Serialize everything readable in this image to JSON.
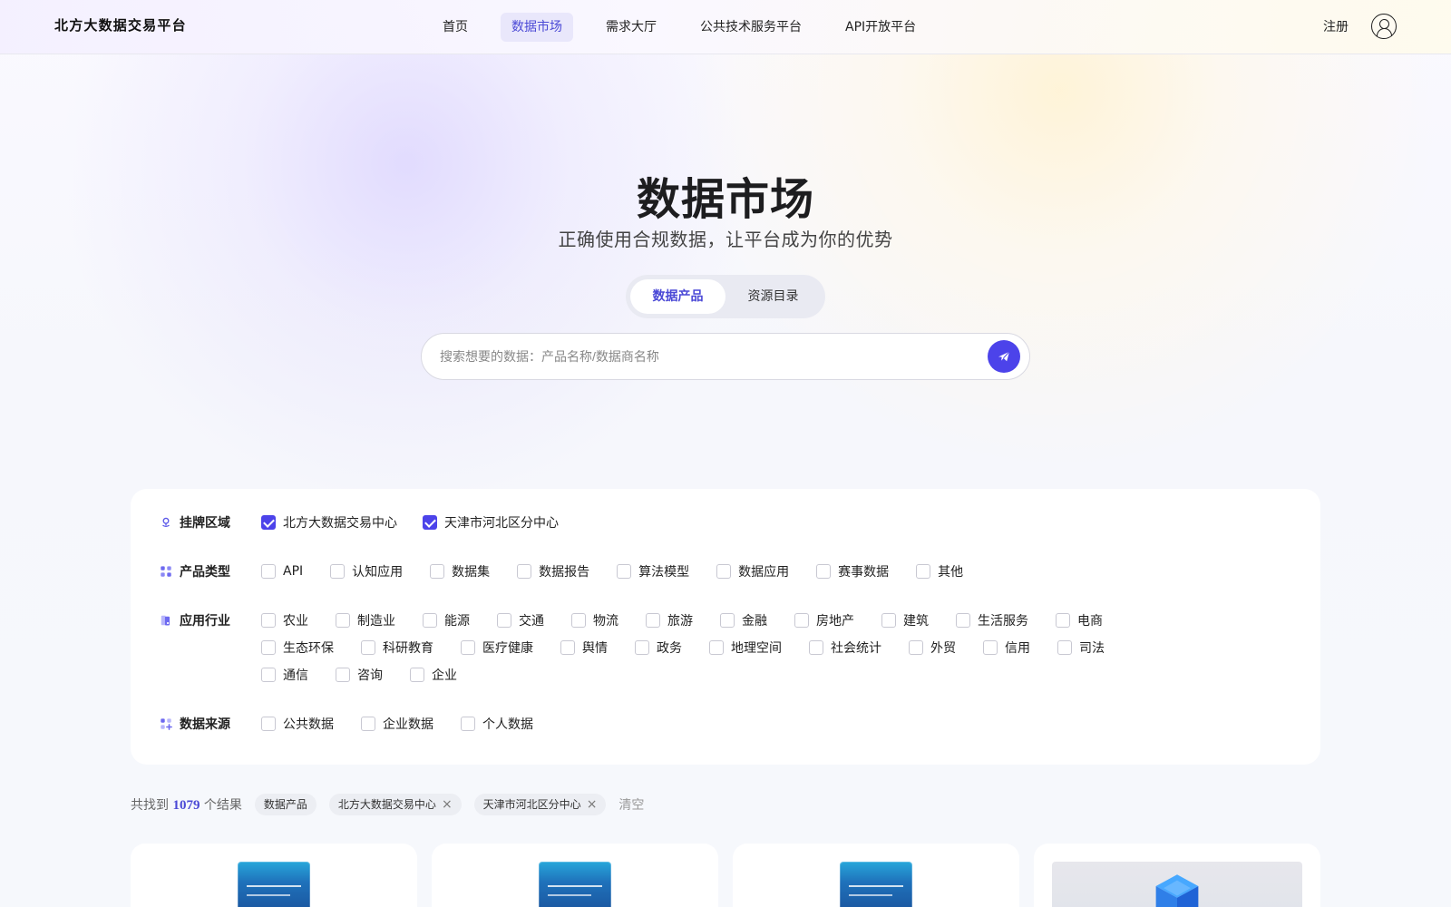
{
  "brand": {
    "title": "北方大数据交易平台"
  },
  "nav": {
    "items": [
      {
        "label": "首页"
      },
      {
        "label": "数据市场",
        "active": true
      },
      {
        "label": "需求大厅"
      },
      {
        "label": "公共技术服务平台"
      },
      {
        "label": "API开放平台"
      }
    ],
    "register": "注册"
  },
  "hero": {
    "title": "数据市场",
    "subtitle": "正确使用合规数据，让平台成为你的优势"
  },
  "toggle": {
    "items": [
      {
        "label": "数据产品",
        "active": true
      },
      {
        "label": "资源目录"
      }
    ]
  },
  "search": {
    "placeholder": "搜索想要的数据：产品名称/数据商名称"
  },
  "filters": {
    "region": {
      "label": "挂牌区域",
      "options": [
        {
          "label": "北方大数据交易中心",
          "checked": true
        },
        {
          "label": "天津市河北区分中心",
          "checked": true
        }
      ]
    },
    "product_type": {
      "label": "产品类型",
      "options": [
        {
          "label": "API"
        },
        {
          "label": "认知应用"
        },
        {
          "label": "数据集"
        },
        {
          "label": "数据报告"
        },
        {
          "label": "算法模型"
        },
        {
          "label": "数据应用"
        },
        {
          "label": "赛事数据"
        },
        {
          "label": "其他"
        }
      ]
    },
    "industry": {
      "label": "应用行业",
      "lines": [
        [
          {
            "label": "农业"
          },
          {
            "label": "制造业"
          },
          {
            "label": "能源"
          },
          {
            "label": "交通"
          },
          {
            "label": "物流"
          },
          {
            "label": "旅游"
          },
          {
            "label": "金融"
          },
          {
            "label": "房地产"
          },
          {
            "label": "建筑"
          },
          {
            "label": "生活服务"
          },
          {
            "label": "电商"
          }
        ],
        [
          {
            "label": "生态环保"
          },
          {
            "label": "科研教育"
          },
          {
            "label": "医疗健康"
          },
          {
            "label": "舆情"
          },
          {
            "label": "政务"
          },
          {
            "label": "地理空间"
          },
          {
            "label": "社会统计"
          },
          {
            "label": "外贸"
          },
          {
            "label": "信用"
          },
          {
            "label": "司法"
          }
        ],
        [
          {
            "label": "通信"
          },
          {
            "label": "咨询"
          },
          {
            "label": "企业"
          }
        ]
      ]
    },
    "source": {
      "label": "数据来源",
      "options": [
        {
          "label": "公共数据"
        },
        {
          "label": "企业数据"
        },
        {
          "label": "个人数据"
        }
      ]
    }
  },
  "results": {
    "prefix": "共找到",
    "count": "1079",
    "suffix": "个结果",
    "chips": [
      {
        "label": "数据产品"
      },
      {
        "label": "北方大数据交易中心",
        "removable": true
      },
      {
        "label": "天津市河北区分中心",
        "removable": true
      }
    ],
    "clear": "清空"
  },
  "icons": {
    "region": "location-icon",
    "product_type": "grid-icon",
    "industry": "tags-icon",
    "source": "apps-icon",
    "search_submit": "send-icon",
    "avatar": "user-icon",
    "chip_close": "close-icon"
  },
  "colors": {
    "accent": "#4c43ea",
    "active_nav_bg": "#e9e7fb",
    "text_primary": "#222222",
    "text_secondary": "#666666"
  }
}
